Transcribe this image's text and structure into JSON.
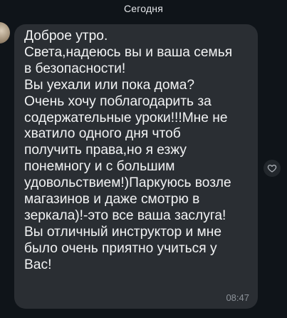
{
  "chat": {
    "date_header": "Сегодня",
    "message": {
      "text": "Доброе утро.\nСвета,надеюсь вы и ваша семья\nв безопасности!\nВы уехали или пока дома?\nОчень хочу поблагодарить за\nсодержательные уроки!!!Мне не\nхватило одного дня чтоб\nполучить права,но я езжу\nпонемногу и с большим\nудовольствием!)Паркуюсь возле\nмагазинов и даже смотрю в\nзеркала)!-это все ваша заслуга!\nВы отличный инструктор и мне\nбыло очень приятно учиться у\nВас!",
      "time": "08:47"
    },
    "icons": {
      "avatar": "avatar",
      "reaction": "heart-icon"
    },
    "colors": {
      "background": "#0f1419",
      "bubble": "#2a2e33",
      "text": "#f2f3f4",
      "timestamp": "#8b9198"
    }
  }
}
